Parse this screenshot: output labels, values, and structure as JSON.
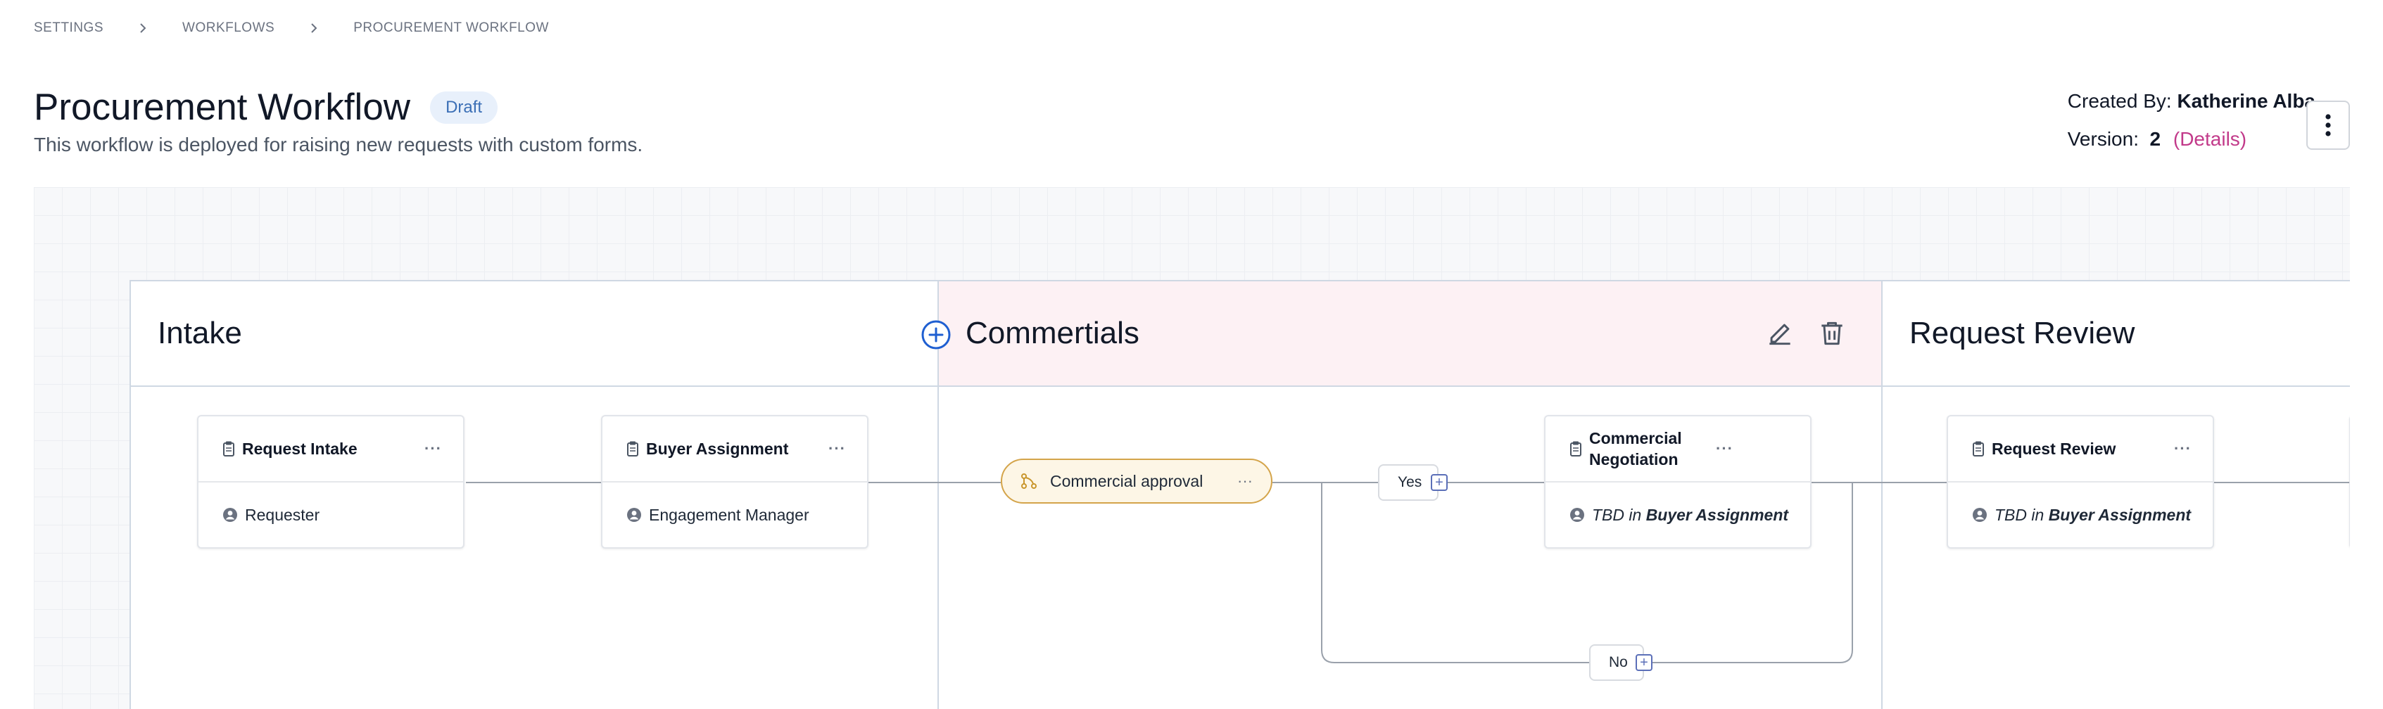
{
  "breadcrumb": {
    "items": [
      "SETTINGS",
      "WORKFLOWS",
      "PROCUREMENT WORKFLOW"
    ]
  },
  "header": {
    "title": "Procurement Workflow",
    "status": "Draft",
    "subtitle": "This workflow is deployed for raising new requests with custom forms.",
    "created_by_label": "Created By:",
    "created_by": "Katherine Alba",
    "version_label": "Version:",
    "version": "2",
    "details_link": "(Details)"
  },
  "stages": [
    {
      "name": "Intake"
    },
    {
      "name": "Commertials"
    },
    {
      "name": "Request Review"
    }
  ],
  "nodes": {
    "request_intake": {
      "title": "Request Intake",
      "more": "···",
      "assignee": "Requester"
    },
    "buyer_assignment": {
      "title": "Buyer Assignment",
      "more": "···",
      "assignee": "Engagement Manager"
    },
    "commercial_negotiation": {
      "title": "Commercial Negotiation",
      "more": "···",
      "assignee_prefix": "TBD",
      "assignee_in": "in",
      "assignee_ref": "Buyer Assignment"
    },
    "request_review": {
      "title": "Request Review",
      "more": "···",
      "assignee_prefix": "TBD",
      "assignee_in": "in",
      "assignee_ref": "Buyer Assignment"
    }
  },
  "decision": {
    "title": "Commercial approval",
    "more": "···"
  },
  "branches": {
    "yes": "Yes",
    "no": "No"
  },
  "colors": {
    "accent": "#1f5fd1",
    "decision_border": "#d4a44a",
    "stage_highlight": "#fdf1f4",
    "link": "#c23a8a"
  },
  "icons": [
    "chevron-right-icon",
    "kebab-icon",
    "clipboard-icon",
    "user-circle-icon",
    "branch-icon",
    "plus-circle-icon",
    "pencil-icon",
    "trash-icon",
    "plus-square-icon"
  ]
}
